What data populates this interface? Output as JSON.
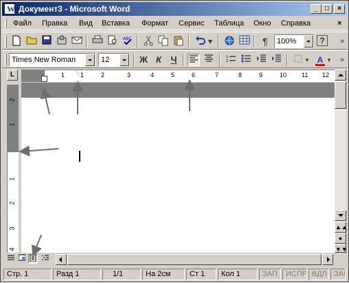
{
  "window": {
    "title": "Документ3 - Microsoft Word",
    "controls": {
      "minimize": "_",
      "maximize": "□",
      "close": "×"
    }
  },
  "menubar": {
    "items": [
      {
        "label": "Файл",
        "accel": "Ф"
      },
      {
        "label": "Правка",
        "accel": "П"
      },
      {
        "label": "Вид",
        "accel": "В"
      },
      {
        "label": "Вставка",
        "accel": "с"
      },
      {
        "label": "Формат",
        "accel": "о"
      },
      {
        "label": "Сервис",
        "accel": "е"
      },
      {
        "label": "Таблица",
        "accel": "Т"
      },
      {
        "label": "Окно",
        "accel": "О"
      },
      {
        "label": "Справка",
        "accel": "С"
      }
    ],
    "close_doc": "×"
  },
  "standard_toolbar": {
    "icons": [
      "new-document-icon",
      "open-folder-icon",
      "save-disk-icon",
      "permissions-icon",
      "email-icon",
      "print-icon",
      "print-preview-icon",
      "spelling-icon",
      "cut-icon",
      "copy-icon",
      "paste-icon",
      "undo-icon",
      "web-icon",
      "table-icon",
      "show-formatting-icon",
      "help-icon"
    ],
    "show_formatting": "¶",
    "zoom_value": "100%",
    "help": "?",
    "overflow": "»"
  },
  "formatting_toolbar": {
    "font_name": "Times New Roman",
    "font_size": "12",
    "bold": "Ж",
    "italic": "К",
    "underline": "Ч",
    "font_color_letter": "A",
    "font_color": "#ff0000",
    "overflow": "»"
  },
  "ruler": {
    "corner": "L",
    "h_numbers": [
      "1",
      "1",
      "2",
      "3",
      "4",
      "5",
      "6",
      "7",
      "8",
      "9",
      "10",
      "11",
      "12"
    ],
    "v_numbers": [
      "2",
      "1",
      "1",
      "2",
      "3",
      "4"
    ]
  },
  "view_buttons": [
    "normal-view-icon",
    "web-layout-icon",
    "print-layout-icon",
    "outline-view-icon"
  ],
  "statusbar": {
    "page": "Стр. 1",
    "section": "Разд 1",
    "page_of": "1/1",
    "position": "На 2см",
    "line": "Ст 1",
    "column": "Кол 1",
    "rec": "ЗАП",
    "trk": "ИСПР",
    "ext": "ВДЛ",
    "ovr": "ЗАМ"
  },
  "colors": {
    "titlebar_start": "#0a246a",
    "titlebar_end": "#a6caf0",
    "chrome": "#d4d0c8",
    "ruler_grey": "#808080"
  }
}
